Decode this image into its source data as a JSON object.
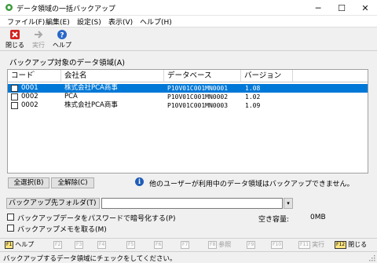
{
  "window": {
    "title": "データ領域の一括バックアップ"
  },
  "window_controls": {
    "minimize": "─",
    "maximize": "☐",
    "close": "✕"
  },
  "menu": [
    "ファイル(F)",
    "編集(E)",
    "設定(S)",
    "表示(V)",
    "ヘルプ(H)"
  ],
  "toolbar": {
    "close_label": "閉じる",
    "run_label": "実行",
    "help_label": "ヘルプ",
    "close_icon": "close-x-icon",
    "run_icon": "run-arrow-icon",
    "help_icon": "help-question-icon"
  },
  "group_label": "バックアップ対象のデータ領域(A)",
  "table": {
    "columns": [
      "コード",
      "会社名",
      "データベース",
      "バージョン"
    ],
    "sort_indicator": "^",
    "rows": [
      {
        "code": "0001",
        "company": "株式会社PCA商事",
        "database": "P10V01C001MN0001",
        "version": "1.08",
        "checked": false,
        "selected": true
      },
      {
        "code": "0002",
        "company": "PCA",
        "database": "P10V01C001MN0002",
        "version": "1.02",
        "checked": false,
        "selected": false
      },
      {
        "code": "0002",
        "company": "株式会社PCA商事",
        "database": "P10V01C001MN0003",
        "version": "1.09",
        "checked": false,
        "selected": false
      }
    ]
  },
  "buttons": {
    "select_all": "全選択(B)",
    "deselect_all": "全解除(C)"
  },
  "info": {
    "icon": "info-icon",
    "text": "他のユーザーが利用中のデータ領域はバックアップできません。"
  },
  "folder": {
    "label": "バックアップ先フォルダ(T)",
    "value": "",
    "dropdown_glyph": "▾"
  },
  "options": {
    "encrypt_label": "バックアップデータをパスワードで暗号化する(P)",
    "encrypt_checked": false,
    "memo_label": "バックアップメモを取る(M)",
    "memo_checked": false
  },
  "free_space": {
    "label": "空き容量:",
    "value": "0MB"
  },
  "fkeys": [
    {
      "key": "F1",
      "label": "ヘルプ",
      "active": true
    },
    {
      "key": "F2",
      "label": "",
      "active": false
    },
    {
      "key": "F3",
      "label": "",
      "active": false
    },
    {
      "key": "F4",
      "label": "",
      "active": false
    },
    {
      "key": "F5",
      "label": "",
      "active": false
    },
    {
      "key": "F6",
      "label": "",
      "active": false
    },
    {
      "key": "F7",
      "label": "",
      "active": false
    },
    {
      "key": "F8",
      "label": "参照",
      "active": false
    },
    {
      "key": "F9",
      "label": "",
      "active": false
    },
    {
      "key": "F10",
      "label": "",
      "active": false
    },
    {
      "key": "F11",
      "label": "実行",
      "active": false
    },
    {
      "key": "F12",
      "label": "閉じる",
      "active": true
    }
  ],
  "status": {
    "text": "バックアップするデータ領域にチェックをしてください。"
  },
  "colors": {
    "selection": "#0078d7",
    "fkey_active": "#ffe680",
    "close_icon": "#d42020",
    "help_icon": "#2a68c8"
  }
}
